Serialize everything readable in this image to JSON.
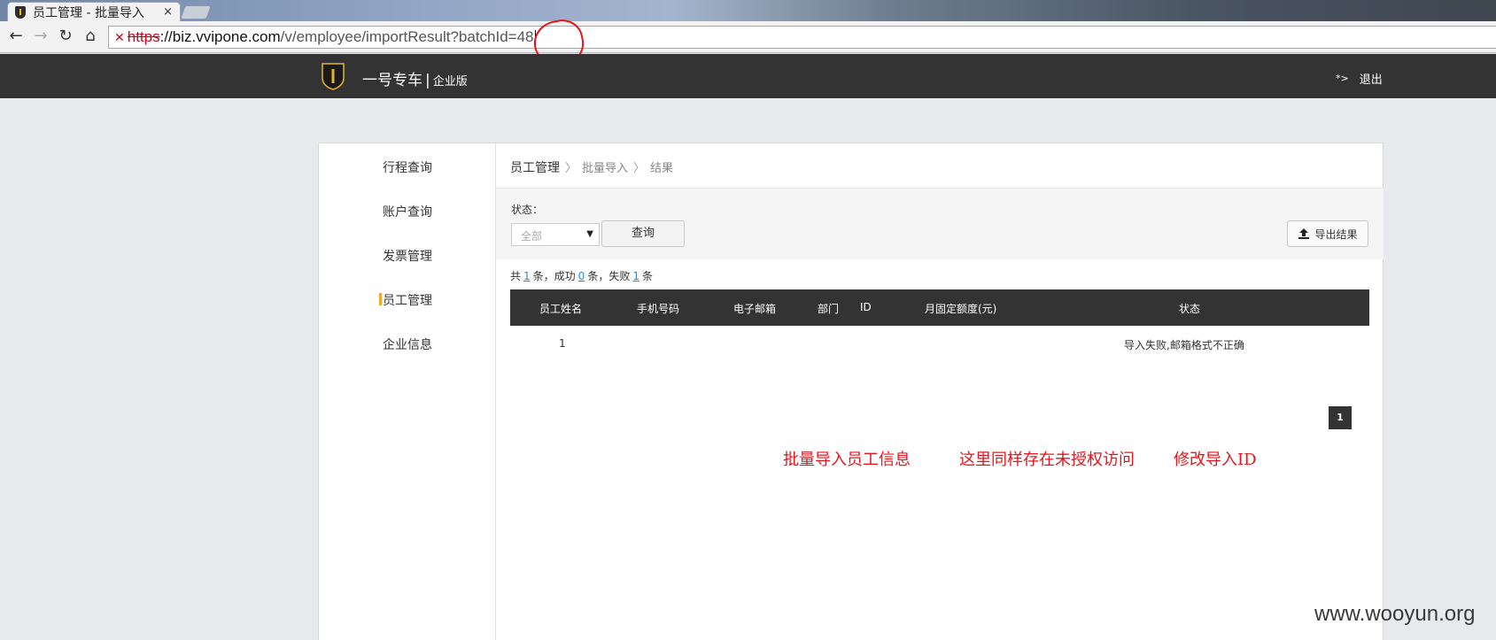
{
  "browser": {
    "tab_title": "员工管理 - 批量导入",
    "tab_close": "×",
    "url_scheme": "https",
    "url_host": "://biz.vvipone.com",
    "url_path": "/v/employee/importResult?batchId=48"
  },
  "header": {
    "brand": "一号专车",
    "brand_sep": "|",
    "brand_sub": "企业版",
    "logout_icon": "*>",
    "logout": "退出"
  },
  "sidebar": {
    "items": [
      {
        "label": "行程查询",
        "active": false
      },
      {
        "label": "账户查询",
        "active": false
      },
      {
        "label": "发票管理",
        "active": false
      },
      {
        "label": "员工管理",
        "active": true
      },
      {
        "label": "企业信息",
        "active": false
      }
    ]
  },
  "breadcrumb": {
    "items": [
      "员工管理",
      "批量导入",
      "结果"
    ],
    "sep": "〉"
  },
  "filter": {
    "status_label": "状态：",
    "status_value": "全部",
    "query_button": "查询",
    "export_button": "导出结果"
  },
  "summary": {
    "prefix": "共",
    "total": "1",
    "unit1": "条，成功",
    "success": "0",
    "unit2": "条，失败",
    "failed": "1",
    "unit3": "条"
  },
  "table": {
    "columns": [
      "员工姓名",
      "手机号码",
      "电子邮箱",
      "部门",
      "ID",
      "月固定额度(元)",
      "状态"
    ],
    "rows": [
      {
        "name": "1",
        "phone": "",
        "email": "",
        "dept": "",
        "id": "",
        "quota": "",
        "status": "导入失败,邮箱格式不正确"
      }
    ]
  },
  "pagination": {
    "current": "1"
  },
  "annotations": {
    "note1": "批量导入员工信息",
    "note2": "这里同样存在未授权访问",
    "note3": "修改导入ID",
    "color": "#e8141b"
  },
  "watermark": "www.wooyun.org"
}
